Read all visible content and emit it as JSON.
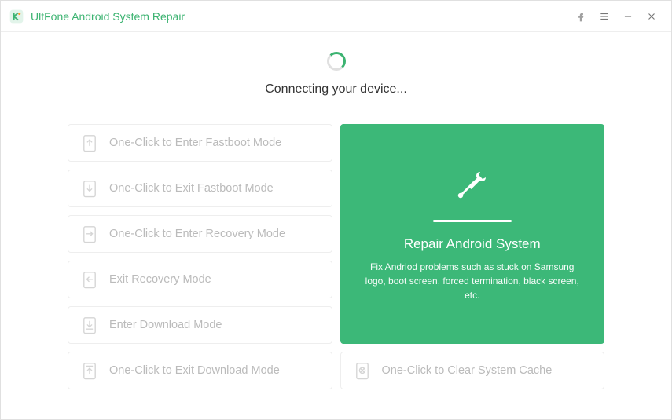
{
  "titlebar": {
    "app_title": "UltFone Android System Repair"
  },
  "status": {
    "text": "Connecting your device..."
  },
  "options": {
    "enter_fastboot": "One-Click to Enter Fastboot Mode",
    "exit_fastboot": "One-Click to Exit Fastboot Mode",
    "enter_recovery": "One-Click to Enter Recovery Mode",
    "exit_recovery": "Exit Recovery Mode",
    "enter_download": "Enter Download Mode",
    "exit_download": "One-Click to Exit Download Mode",
    "clear_cache": "One-Click to Clear System Cache"
  },
  "feature": {
    "title": "Repair Android System",
    "description": "Fix Andriod problems such as stuck on Samsung logo, boot screen, forced termination, black screen, etc."
  }
}
